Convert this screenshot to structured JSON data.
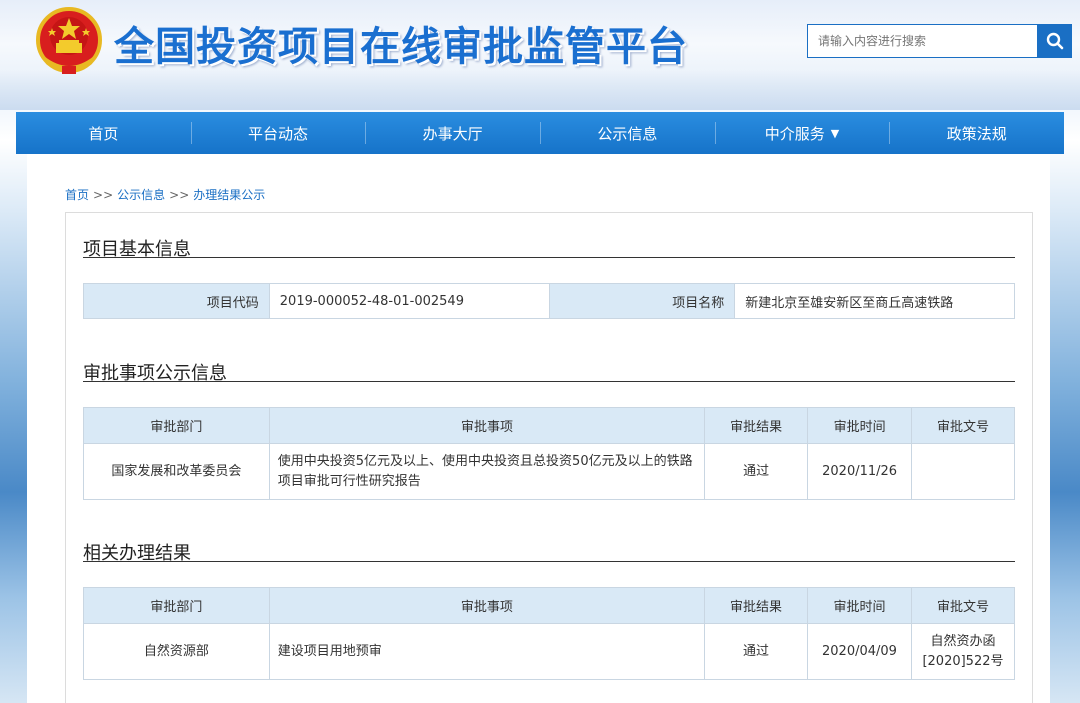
{
  "header": {
    "title": "全国投资项目在线审批监管平台",
    "search_placeholder": "请输入内容进行搜索"
  },
  "nav": [
    {
      "label": "首页"
    },
    {
      "label": "平台动态"
    },
    {
      "label": "办事大厅"
    },
    {
      "label": "公示信息"
    },
    {
      "label": "中介服务",
      "caret": "▼"
    },
    {
      "label": "政策法规"
    }
  ],
  "breadcrumb": {
    "home": "首页",
    "sep": ">>",
    "level2": "公示信息",
    "level3": "办理结果公示"
  },
  "basic": {
    "title": "项目基本信息",
    "code_label": "项目代码",
    "code_value": "2019-000052-48-01-002549",
    "name_label": "项目名称",
    "name_value": "新建北京至雄安新区至商丘高速铁路"
  },
  "approval": {
    "title": "审批事项公示信息",
    "headers": [
      "审批部门",
      "审批事项",
      "审批结果",
      "审批时间",
      "审批文号"
    ],
    "rows": [
      {
        "dept": "国家发展和改革委员会",
        "item": "使用中央投资5亿元及以上、使用中央投资且总投资50亿元及以上的铁路项目审批可行性研究报告",
        "result": "通过",
        "date": "2020/11/26",
        "doc_no": ""
      }
    ]
  },
  "related": {
    "title": "相关办理结果",
    "headers": [
      "审批部门",
      "审批事项",
      "审批结果",
      "审批时间",
      "审批文号"
    ],
    "rows": [
      {
        "dept": "自然资源部",
        "item": "建设项目用地预审",
        "result": "通过",
        "date": "2020/04/09",
        "doc_no": "自然资办函[2020]522号"
      }
    ]
  },
  "colors": {
    "brand_blue": "#1a6fc4",
    "nav_blue": "#1f80d6",
    "table_header_bg": "#d9e9f6"
  },
  "icons": {
    "emblem": "national-emblem-icon",
    "search": "search-icon"
  }
}
